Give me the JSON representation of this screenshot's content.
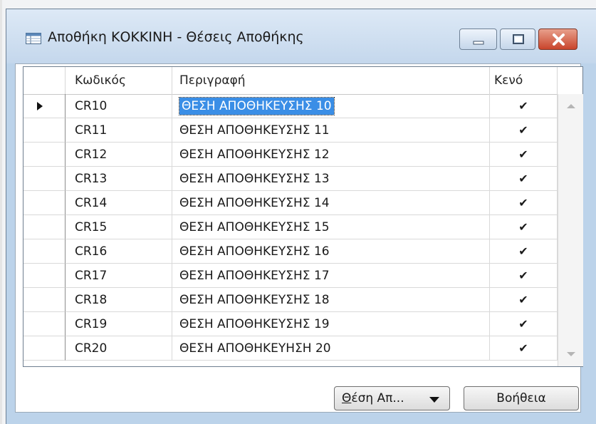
{
  "window": {
    "title": "Αποθήκη ΚΟΚΚΙΝΗ - Θέσεις Αποθήκης",
    "icon": "table-form-icon",
    "controls": [
      "minimize",
      "maximize",
      "close"
    ]
  },
  "grid": {
    "columns": {
      "code": "Κωδικός",
      "description": "Περιγραφή",
      "empty": "Κενό"
    },
    "rows": [
      {
        "code": "CR10",
        "description": "ΘΕΣΗ ΑΠΟΘΗΚΕΥΣΗΣ 10",
        "empty": "✔",
        "selected": true
      },
      {
        "code": "CR11",
        "description": "ΘΕΣΗ ΑΠΟΘΗΚΕΥΣΗΣ 11",
        "empty": "✔"
      },
      {
        "code": "CR12",
        "description": "ΘΕΣΗ ΑΠΟΘΗΚΕΥΣΗΣ 12",
        "empty": "✔"
      },
      {
        "code": "CR13",
        "description": "ΘΕΣΗ ΑΠΟΘΗΚΕΥΣΗΣ 13",
        "empty": "✔"
      },
      {
        "code": "CR14",
        "description": "ΘΕΣΗ ΑΠΟΘΗΚΕΥΣΗΣ 14",
        "empty": "✔"
      },
      {
        "code": "CR15",
        "description": "ΘΕΣΗ ΑΠΟΘΗΚΕΥΣΗΣ 15",
        "empty": "✔"
      },
      {
        "code": "CR16",
        "description": "ΘΕΣΗ ΑΠΟΘΗΚΕΥΣΗΣ 16",
        "empty": "✔"
      },
      {
        "code": "CR17",
        "description": "ΘΕΣΗ ΑΠΟΘΗΚΕΥΣΗΣ 17",
        "empty": "✔"
      },
      {
        "code": "CR18",
        "description": "ΘΕΣΗ ΑΠΟΘΗΚΕΥΣΗΣ 18",
        "empty": "✔"
      },
      {
        "code": "CR19",
        "description": "ΘΕΣΗ ΑΠΟΘΗΚΕΥΣΗΣ 19",
        "empty": "✔"
      },
      {
        "code": "CR20",
        "description": "ΘΕΣΗ ΑΠΟΘΗΚΕΥΗΣΗ 20",
        "empty": "✔"
      }
    ]
  },
  "buttons": {
    "bin_menu": {
      "accel": "Θ",
      "rest": "έση Απ..."
    },
    "help": "Βοήθεια"
  },
  "colors": {
    "selection": "#3a8ee6",
    "frame": "#bcd3ea",
    "close_button": "#c9452c"
  }
}
